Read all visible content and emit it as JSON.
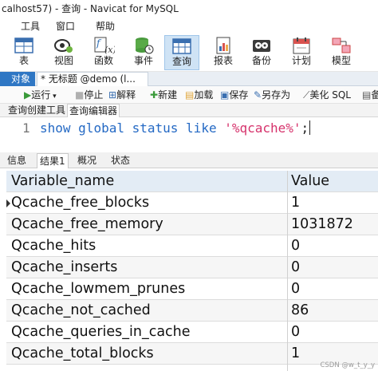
{
  "window": {
    "title": "calhost57) - 查询 - Navicat for MySQL"
  },
  "menu": {
    "items": [
      "工具",
      "窗口",
      "帮助"
    ]
  },
  "toolbar": {
    "items": [
      {
        "label": "表",
        "icon": "table-icon"
      },
      {
        "label": "视图",
        "icon": "view-icon"
      },
      {
        "label": "函数",
        "icon": "function-icon"
      },
      {
        "label": "事件",
        "icon": "event-icon"
      },
      {
        "label": "查询",
        "icon": "query-icon",
        "active": true
      },
      {
        "label": "报表",
        "icon": "report-icon"
      },
      {
        "label": "备份",
        "icon": "backup-icon"
      },
      {
        "label": "计划",
        "icon": "schedule-icon"
      },
      {
        "label": "模型",
        "icon": "model-icon"
      }
    ]
  },
  "tabs": {
    "objects": "对象",
    "query": "* 无标题 @demo (l..."
  },
  "query_toolbar": {
    "run": "运行",
    "stop": "停止",
    "explain": "解释",
    "new": "新建",
    "load": "加载",
    "save": "保存",
    "save_as": "另存为",
    "beautify": "美化 SQL",
    "more": "备"
  },
  "subtabs": {
    "builder": "查询创建工具",
    "editor": "查询编辑器"
  },
  "editor": {
    "line_number": "1",
    "kw1": "show",
    "kw2": "global",
    "kw3": "status",
    "kw4": "like",
    "literal": "'%qcache%'",
    "terminator": ";"
  },
  "result_tabs": [
    "信息",
    "结果1",
    "概况",
    "状态"
  ],
  "grid": {
    "columns": [
      "Variable_name",
      "Value"
    ],
    "rows": [
      [
        "Qcache_free_blocks",
        "1"
      ],
      [
        "Qcache_free_memory",
        "1031872"
      ],
      [
        "Qcache_hits",
        "0"
      ],
      [
        "Qcache_inserts",
        "0"
      ],
      [
        "Qcache_lowmem_prunes",
        "0"
      ],
      [
        "Qcache_not_cached",
        "86"
      ],
      [
        "Qcache_queries_in_cache",
        "0"
      ],
      [
        "Qcache_total_blocks",
        "1"
      ]
    ]
  },
  "watermark": "CSDN @w_t_y_y"
}
